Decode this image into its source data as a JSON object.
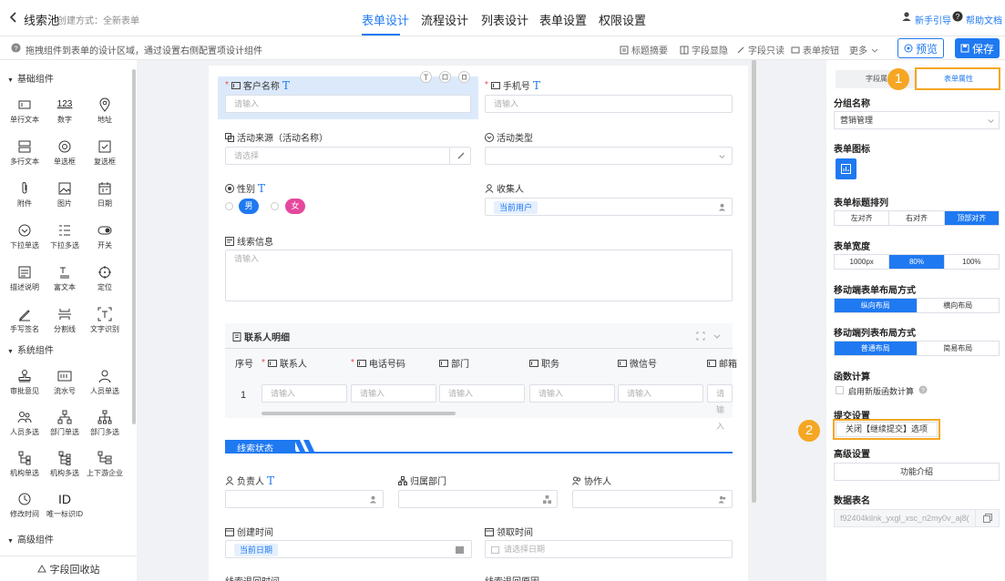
{
  "header": {
    "title": "线索池",
    "subtitle": "创建方式：全新表单",
    "tabs": [
      "表单设计",
      "流程设计",
      "列表设计",
      "表单设置",
      "权限设置"
    ],
    "active_tab": 0,
    "guide_link": "新手引导",
    "help_link": "帮助文档"
  },
  "toolbar": {
    "tip": "拖拽组件到表单的设计区域，通过设置右侧配置项设计组件",
    "buttons": [
      "标题摘要",
      "字段显隐",
      "字段只读",
      "表单按钮",
      "更多"
    ],
    "preview": "预览",
    "save": "保存"
  },
  "left": {
    "groups": [
      {
        "title": "基础组件",
        "items": [
          {
            "label": "单行文本",
            "icon": "single-line-text-icon"
          },
          {
            "label": "数字",
            "icon": "number-icon",
            "glyph": "123"
          },
          {
            "label": "地址",
            "icon": "location-pin-icon"
          },
          {
            "label": "多行文本",
            "icon": "multi-line-text-icon"
          },
          {
            "label": "单选框",
            "icon": "radio-icon"
          },
          {
            "label": "复选框",
            "icon": "checkbox-icon"
          },
          {
            "label": "附件",
            "icon": "paperclip-icon"
          },
          {
            "label": "图片",
            "icon": "image-icon"
          },
          {
            "label": "日期",
            "icon": "calendar-icon"
          },
          {
            "label": "下拉单选",
            "icon": "dropdown-icon"
          },
          {
            "label": "下拉多选",
            "icon": "dropdown-multi-icon"
          },
          {
            "label": "开关",
            "icon": "toggle-icon"
          },
          {
            "label": "描述说明",
            "icon": "description-icon"
          },
          {
            "label": "富文本",
            "icon": "rich-text-icon"
          },
          {
            "label": "定位",
            "icon": "crosshair-icon"
          },
          {
            "label": "手写签名",
            "icon": "pen-icon"
          },
          {
            "label": "分割线",
            "icon": "divider-icon"
          },
          {
            "label": "文字识别",
            "icon": "ocr-icon"
          }
        ]
      },
      {
        "title": "系统组件",
        "items": [
          {
            "label": "审批意见",
            "icon": "stamp-icon"
          },
          {
            "label": "流水号",
            "icon": "serial-icon"
          },
          {
            "label": "人员单选",
            "icon": "person-icon"
          },
          {
            "label": "人员多选",
            "icon": "people-icon"
          },
          {
            "label": "部门单选",
            "icon": "org-icon"
          },
          {
            "label": "部门多选",
            "icon": "org-multi-icon"
          },
          {
            "label": "机构单选",
            "icon": "institution-icon"
          },
          {
            "label": "机构多选",
            "icon": "institution-multi-icon"
          },
          {
            "label": "上下游企业",
            "icon": "supply-chain-icon"
          },
          {
            "label": "修改时间",
            "icon": "clock-icon"
          },
          {
            "label": "唯一标识ID",
            "icon": "id-icon",
            "glyph": "ID"
          }
        ]
      },
      {
        "title": "高级组件",
        "items": []
      }
    ],
    "recycle": "字段回收站"
  },
  "canvas": {
    "customer_name": {
      "label": "客户名称",
      "placeholder": "请输入"
    },
    "phone": {
      "label": "手机号",
      "placeholder": "请输入"
    },
    "source": {
      "label": "活动来源（活动名称）",
      "placeholder": "请选择"
    },
    "activity_type": {
      "label": "活动类型"
    },
    "gender": {
      "label": "性别",
      "options": [
        "男",
        "女"
      ]
    },
    "collector": {
      "label": "收集人",
      "value": "当前用户"
    },
    "lead_info": {
      "label": "线索信息",
      "placeholder": "请输入"
    },
    "contacts": {
      "title": "联系人明细",
      "columns": [
        "序号",
        "联系人",
        "电话号码",
        "部门",
        "职务",
        "微信号",
        "邮箱"
      ],
      "row_index": "1",
      "placeholder": "请输入"
    },
    "section": "线索状态",
    "owner": {
      "label": "负责人"
    },
    "dept": {
      "label": "归属部门"
    },
    "collab": {
      "label": "协作人"
    },
    "created": {
      "label": "创建时间",
      "value": "当前日期"
    },
    "received": {
      "label": "领取时间",
      "placeholder": "请选择日期"
    },
    "bottom_left": "线索退回时间",
    "bottom_right": "线索退回原因"
  },
  "right": {
    "tabs": [
      "字段属",
      "表单属性"
    ],
    "group_name": {
      "label": "分组名称",
      "value": "营销管理"
    },
    "form_icon": {
      "label": "表单图标"
    },
    "title_align": {
      "label": "表单标题排列",
      "options": [
        "左对齐",
        "右对齐",
        "顶部对齐"
      ],
      "selected": 2
    },
    "form_width": {
      "label": "表单宽度",
      "options": [
        "1000px",
        "80%",
        "100%"
      ],
      "selected": 1
    },
    "mobile_form": {
      "label": "移动端表单布局方式",
      "options": [
        "纵向布局",
        "横向布局"
      ],
      "selected": 0
    },
    "mobile_list": {
      "label": "移动端列表布局方式",
      "options": [
        "普通布局",
        "简易布局"
      ],
      "selected": 0
    },
    "func_calc": {
      "label": "函数计算",
      "checkbox": "启用新版函数计算"
    },
    "submit": {
      "label": "提交设置",
      "button": "关闭【继续提交】选项"
    },
    "advanced": {
      "label": "高级设置",
      "button": "功能介绍"
    },
    "data_table": {
      "label": "数据表名",
      "value": "f92404kilnk_yxgl_xsc_n2my0v_aj8("
    },
    "badges": [
      "1",
      "2"
    ]
  },
  "colors": {
    "accent": "#1f79f1",
    "highlight": "#f5a623",
    "female": "#e5489d"
  }
}
